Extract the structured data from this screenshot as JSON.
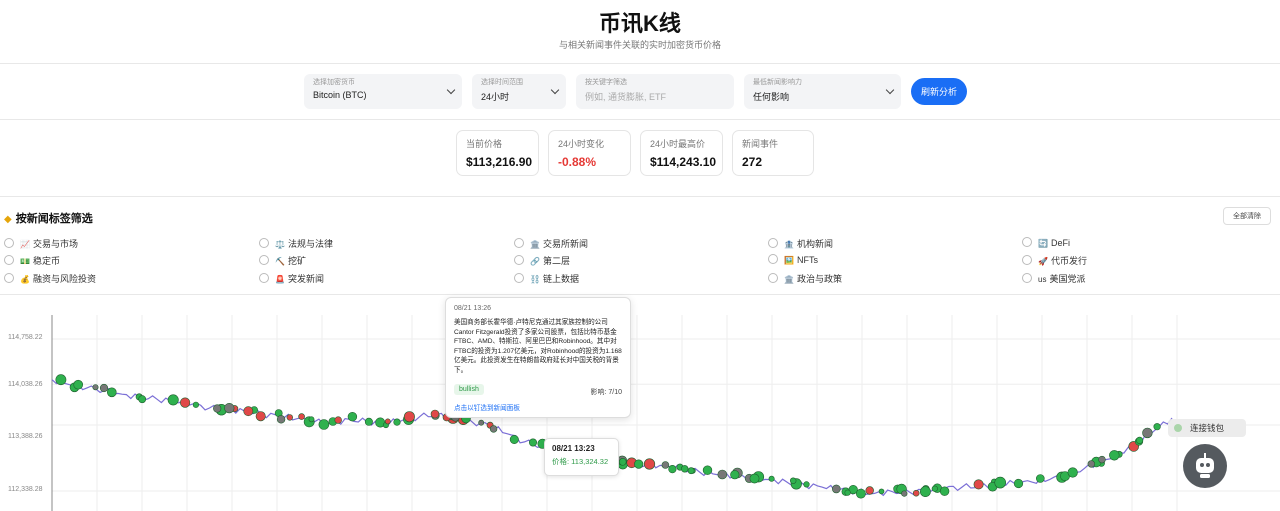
{
  "header": {
    "title": "币讯K线",
    "subtitle": "与相关新闻事件关联的实时加密货币价格"
  },
  "controls": {
    "currency": {
      "label": "选择加密货币",
      "value": "Bitcoin (BTC)"
    },
    "timerange": {
      "label": "选择时间范围",
      "value": "24小时"
    },
    "keyword": {
      "label": "按关键字筛选",
      "placeholder": "例如, 通货膨胀, ETF"
    },
    "impact": {
      "label": "最低新闻影响力",
      "value": "任何影响"
    },
    "refresh_label": "刷新分析"
  },
  "stats": [
    {
      "label": "当前价格",
      "value": "$113,216.90"
    },
    {
      "label": "24小时变化",
      "value": "-0.88%"
    },
    {
      "label": "24小时最高价",
      "value": "$114,243.10"
    },
    {
      "label": "新闻事件",
      "value": "272"
    }
  ],
  "tags": {
    "heading": "按新闻标签筛选",
    "clear_label": "全部清除",
    "items": [
      {
        "emoji": "📈",
        "label": "交易与市场"
      },
      {
        "emoji": "⚖️",
        "label": "法规与法律"
      },
      {
        "emoji": "🏛️",
        "label": "交易所新闻"
      },
      {
        "emoji": "🏦",
        "label": "机构新闻"
      },
      {
        "emoji": "🔄",
        "label": "DeFi"
      },
      {
        "emoji": "💵",
        "label": "稳定币"
      },
      {
        "emoji": "⛏️",
        "label": "挖矿"
      },
      {
        "emoji": "🔗",
        "label": "第二层"
      },
      {
        "emoji": "🖼️",
        "label": "NFTs"
      },
      {
        "emoji": "🚀",
        "label": "代币发行"
      },
      {
        "emoji": "💰",
        "label": "融资与风险投资"
      },
      {
        "emoji": "🚨",
        "label": "突发新闻"
      },
      {
        "emoji": "⛓️",
        "label": "链上数据"
      },
      {
        "emoji": "🏛️",
        "label": "政治与政策"
      },
      {
        "emoji": "us",
        "label": "美国党派"
      }
    ]
  },
  "chart": {
    "y_ticks": [
      "114,758.22",
      "114,038.26",
      "113,388.26",
      "112,338.28"
    ]
  },
  "tooltip": {
    "time": "08/21 13:26",
    "body": "美国商务部长霍华德·卢特尼克通过其家族控制的公司Cantor Fitzgerald投资了多家公司股票，包括比特币基金FTBC、AMD、特斯拉、阿里巴巴和Robinhood。其中对FTBC的投资为1.207亿美元，对Robinhood的投资为1.168亿美元。此投资发生在特朗普政府延长对中国关税的背景下。",
    "sentiment": "bullish",
    "impact": "影响: 7/10",
    "link": "点击以钉选到新闻面板"
  },
  "hover_card": {
    "time": "08/21 13:23",
    "price": "价格: 113,324.32"
  },
  "wallet_label": "连接钱包",
  "chart_data": {
    "type": "line",
    "y_ticks": [
      114758.22,
      114038.26,
      113388.26,
      112338.28
    ],
    "series": [
      {
        "values": [
          114110,
          114030,
          113980,
          113940,
          113880,
          113830,
          113800,
          113760,
          113720,
          113660,
          113640,
          113610,
          113560,
          113530,
          113490,
          113440,
          113420,
          113480,
          113440,
          113420,
          113460,
          113520,
          113560,
          113500,
          113440,
          113380,
          113250,
          113120,
          113050,
          112990,
          112900,
          112820,
          112800,
          112780,
          112760,
          112740,
          112700,
          112640,
          112600,
          112580,
          112560,
          112520,
          112480,
          112430,
          112400,
          112360,
          112330,
          112300,
          112330,
          112320,
          112350,
          112380,
          112400,
          112420,
          112450,
          112460,
          112480,
          112520,
          112600,
          112700,
          112820,
          112950,
          113100,
          113300,
          113500
        ]
      }
    ],
    "markers": {
      "bullish_color": "#2fb14e",
      "bearish_color": "#e04848",
      "neutral_color": "#777777"
    },
    "line_color": "#7b6fd6"
  }
}
